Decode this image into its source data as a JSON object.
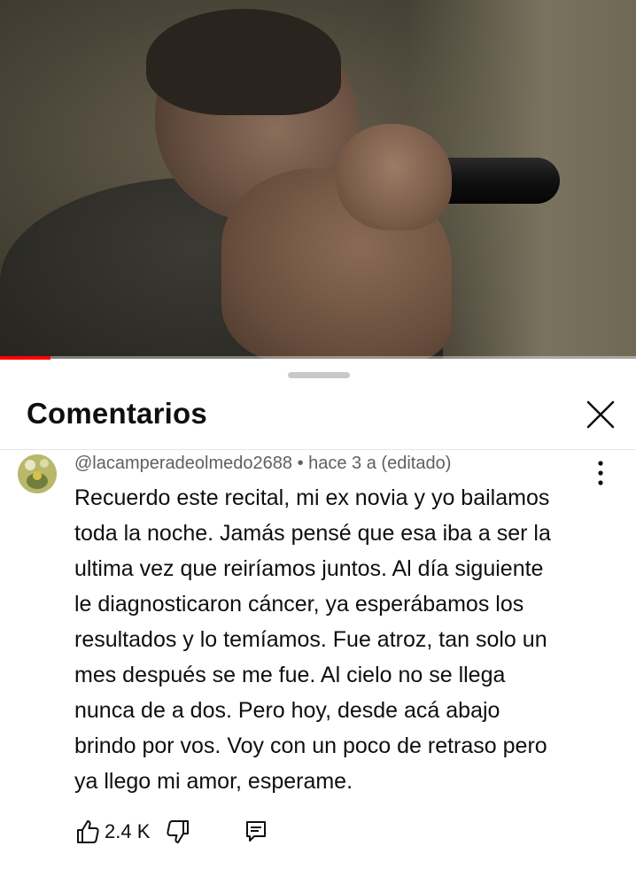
{
  "video": {
    "progress_fraction": 0.08
  },
  "sheet": {
    "title": "Comentarios",
    "close_icon": "close-icon"
  },
  "comment": {
    "meta": "@lacamperadeolmedo2688 • hace 3 a (editado)",
    "lines": [
      "Recuerdo este recital, mi ex novia y yo bailamos",
      "toda la noche. Jamás pensé que esa iba a ser la",
      "ultima vez que reiríamos juntos. Al día siguiente",
      "le diagnosticaron cáncer, ya esperábamos los",
      "resultados y lo temíamos. Fue atroz, tan solo un",
      "mes después se me fue. Al cielo no se llega",
      "nunca de a dos. Pero hoy, desde acá abajo",
      "brindo por vos. Voy con un poco de retraso pero",
      "ya llego mi amor, esperame."
    ],
    "like_count": "2.4 K",
    "icons": [
      "thumbs-up-icon",
      "thumbs-down-icon",
      "reply-icon",
      "more-vertical-icon"
    ]
  },
  "colors": {
    "progress": "#ff0000",
    "text_primary": "#0f0f0f",
    "text_secondary": "#606060"
  }
}
